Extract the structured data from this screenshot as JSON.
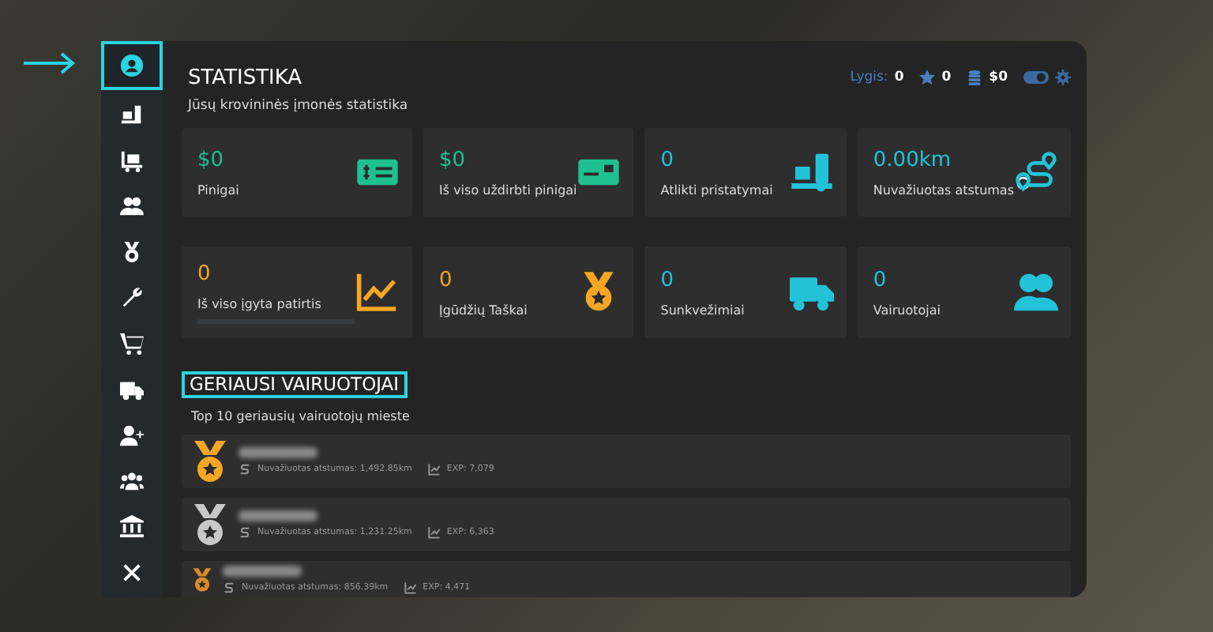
{
  "sidebar": {
    "items": [
      {
        "kind": "user",
        "selected": true
      },
      {
        "kind": "dolly",
        "selected": false
      },
      {
        "kind": "cart-box",
        "selected": false
      },
      {
        "kind": "users",
        "selected": false
      },
      {
        "kind": "medal",
        "selected": false
      },
      {
        "kind": "wrench",
        "selected": false
      },
      {
        "kind": "cart",
        "selected": false
      },
      {
        "kind": "truck",
        "selected": false
      },
      {
        "kind": "user-plus",
        "selected": false
      },
      {
        "kind": "group",
        "selected": false
      },
      {
        "kind": "bank",
        "selected": false
      },
      {
        "kind": "close",
        "selected": false
      }
    ]
  },
  "header": {
    "title": "STATISTIKA",
    "subtitle": "Jūsų krovininės įmonės statistika",
    "level_label": "Lygis:",
    "level": "0",
    "stars": "0",
    "money": "$0"
  },
  "stats": [
    {
      "value": "$0",
      "label": "Pinigai",
      "kind": "cash",
      "color": "#1fc08f"
    },
    {
      "value": "$0",
      "label": "Iš viso uždirbti pinigai",
      "kind": "card",
      "color": "#1fc08f"
    },
    {
      "value": "0",
      "label": "Atlikti pristatymai",
      "kind": "dolly",
      "color": "#22c3d8"
    },
    {
      "value": "0.00km",
      "label": "Nuvažiuotas atstumas",
      "kind": "route",
      "color": "#22c3d8"
    },
    {
      "value": "0",
      "label": "Iš viso įgyta patirtis",
      "kind": "chart",
      "color": "#f5a623",
      "level": 0
    },
    {
      "value": "0",
      "label": "Įgūdžių Taškai",
      "kind": "medal",
      "color": "#f5a623"
    },
    {
      "value": "0",
      "label": "Sunkvežimiai",
      "kind": "truck",
      "color": "#22c3d8"
    },
    {
      "value": "0",
      "label": "Vairuotojai",
      "kind": "users",
      "color": "#22c3d8"
    }
  ],
  "drivers_section": {
    "title": "GERIAUSI VAIRUOTOJAI",
    "subtitle": "Top 10 geriausių vairuotojų mieste"
  },
  "drivers": [
    {
      "distance": "Nuvažiuotas atstumas: 1,492.85km",
      "exp": "EXP: 7,079",
      "color": "#f5a623"
    },
    {
      "distance": "Nuvažiuotas atstumas: 1,231.25km",
      "exp": "EXP: 6,363",
      "color": "#c8c8c8"
    },
    {
      "distance": "Nuvažiuotas atstumas: 856.39km",
      "exp": "EXP: 4,471",
      "color": "#d9892b"
    }
  ]
}
